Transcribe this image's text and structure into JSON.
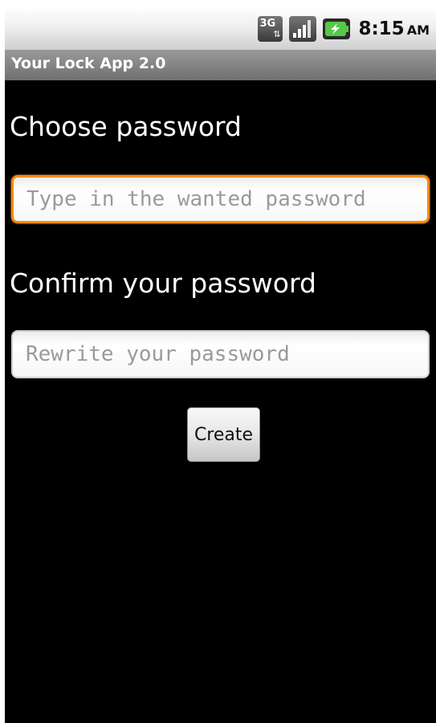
{
  "status_bar": {
    "network_type": "3G",
    "network_icon": "3g-data-icon",
    "signal_icon": "signal-strength-icon",
    "battery_icon": "battery-charging-icon",
    "time": "8:15",
    "ampm": "AM"
  },
  "app": {
    "title": "Your Lock App 2.0"
  },
  "form": {
    "choose_label": "Choose password",
    "choose_placeholder": "Type in the wanted password",
    "choose_value": "",
    "confirm_label": "Confirm your password",
    "confirm_placeholder": "Rewrite your password",
    "confirm_value": "",
    "create_label": "Create"
  },
  "colors": {
    "background": "#000000",
    "focus_border": "#ff8a00",
    "battery_accent": "#55c84a"
  }
}
